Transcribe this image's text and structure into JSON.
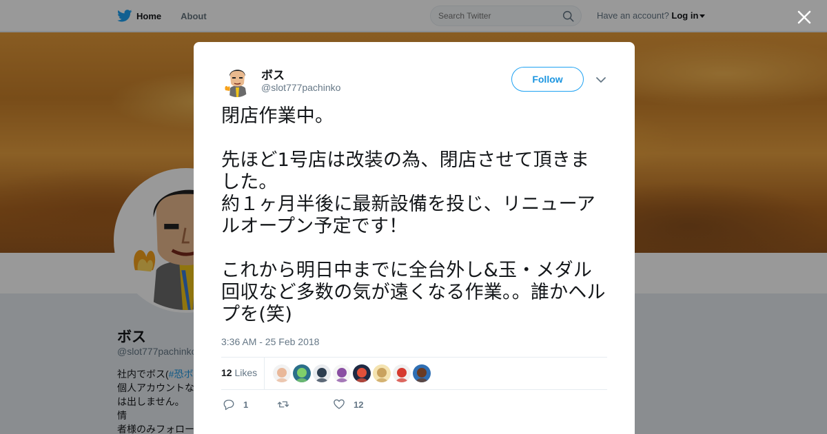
{
  "nav": {
    "home_label": "Home",
    "about_label": "About",
    "search_placeholder": "Search Twitter",
    "account_prompt": "Have an account?",
    "login_label": "Log in"
  },
  "profile": {
    "name": "ボス",
    "handle": "@slot777pachinko",
    "bio_prefix": "社内でボス(",
    "bio_tag": "#恐ボ",
    "bio_rest": "個人アカウントな\nは出しません。 情\n者様のみフォロー\nしくお願い致しま"
  },
  "tweet": {
    "author_name": "ボス",
    "author_handle": "@slot777pachinko",
    "follow_label": "Follow",
    "text": "閉店作業中。\n\n先ほど1号店は改装の為、閉店させて頂きました。\n約１ヶ月半後に最新設備を投じ、リニューアルオープン予定です！\n\nこれから明日中までに全台外し&玉・メダル回収など多数の気が遠くなる作業。。誰かヘルプを(笑)",
    "timestamp": "3:36 AM - 25 Feb 2018",
    "likes_count": "12",
    "likes_label": "Likes",
    "reply_count": "1",
    "retweet_count": "",
    "like_count": "12"
  },
  "likers": [
    {
      "name": "liker-1",
      "bg": "#f2f2f2",
      "fg": "#e9b89a"
    },
    {
      "name": "liker-2",
      "bg": "#2b6f8a",
      "fg": "#7fcf6a"
    },
    {
      "name": "liker-3",
      "bg": "#e9ecef",
      "fg": "#2d3e50"
    },
    {
      "name": "liker-4",
      "bg": "#f5f5f5",
      "fg": "#8a4fa3"
    },
    {
      "name": "liker-5",
      "bg": "#1f2a44",
      "fg": "#e2503a"
    },
    {
      "name": "liker-6",
      "bg": "#f4e3b0",
      "fg": "#c9a25e"
    },
    {
      "name": "liker-7",
      "bg": "#f0f0f0",
      "fg": "#d63a2f"
    },
    {
      "name": "liker-8",
      "bg": "#2f6fb3",
      "fg": "#6a3b22"
    }
  ],
  "colors": {
    "accent": "#1da1f2",
    "link": "#1b95e0",
    "muted": "#657786"
  }
}
